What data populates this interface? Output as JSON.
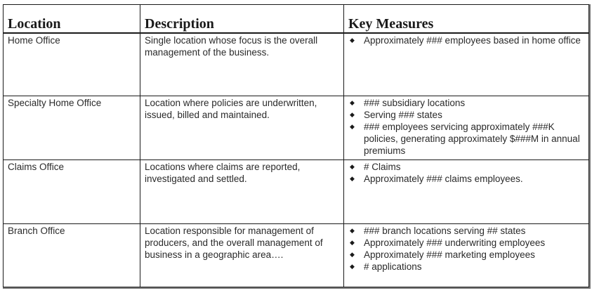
{
  "table": {
    "headers": {
      "location": "Location",
      "description": "Description",
      "measures": "Key Measures"
    },
    "bullet_glyph": "◆",
    "rows": [
      {
        "location": "Home Office",
        "description": "Single location whose focus is the overall management of the business.",
        "measures": [
          "Approximately ### employees based in home office"
        ]
      },
      {
        "location": "Specialty Home Office",
        "description": "Location where policies are underwritten, issued, billed and maintained.",
        "measures": [
          "### subsidiary locations",
          "Serving ### states",
          "### employees servicing approximately ###K policies, generating approximately $###M in annual premiums"
        ]
      },
      {
        "location": "Claims Office",
        "description": "Locations where claims are reported, investigated and settled.",
        "measures": [
          "# Claims",
          "Approximately ### claims employees."
        ]
      },
      {
        "location": "Branch Office",
        "description": "Location responsible for management of producers, and the overall management of business in a geographic area….",
        "measures": [
          "### branch locations serving ## states",
          "Approximately ### underwriting employees",
          "Approximately ### marketing employees",
          "# applications"
        ]
      }
    ]
  }
}
